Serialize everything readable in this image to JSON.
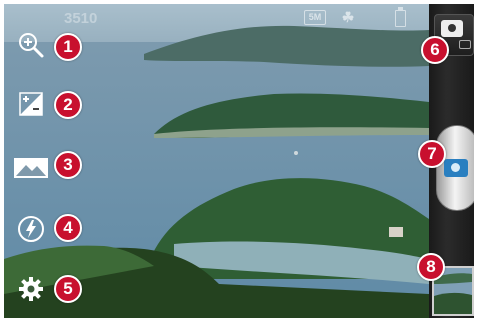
{
  "status_bar": {
    "shots_remaining": "3510",
    "image_size_label": "5M",
    "scene_mode_icon": "scene-mode-icon",
    "battery_icon": "battery-icon"
  },
  "controls": [
    {
      "icon": "zoom-icon",
      "number": "1"
    },
    {
      "icon": "brightness-icon",
      "number": "2"
    },
    {
      "icon": "scene-icon",
      "number": "3"
    },
    {
      "icon": "flash-icon",
      "number": "4"
    },
    {
      "icon": "settings-icon",
      "number": "5"
    }
  ],
  "right_panel": {
    "mode_switch_number": "6",
    "shutter_number": "7",
    "gallery_number": "8"
  },
  "colors": {
    "badge": "#c8102e",
    "shutter_accent": "#2a7fc0",
    "panel": "#222222"
  }
}
